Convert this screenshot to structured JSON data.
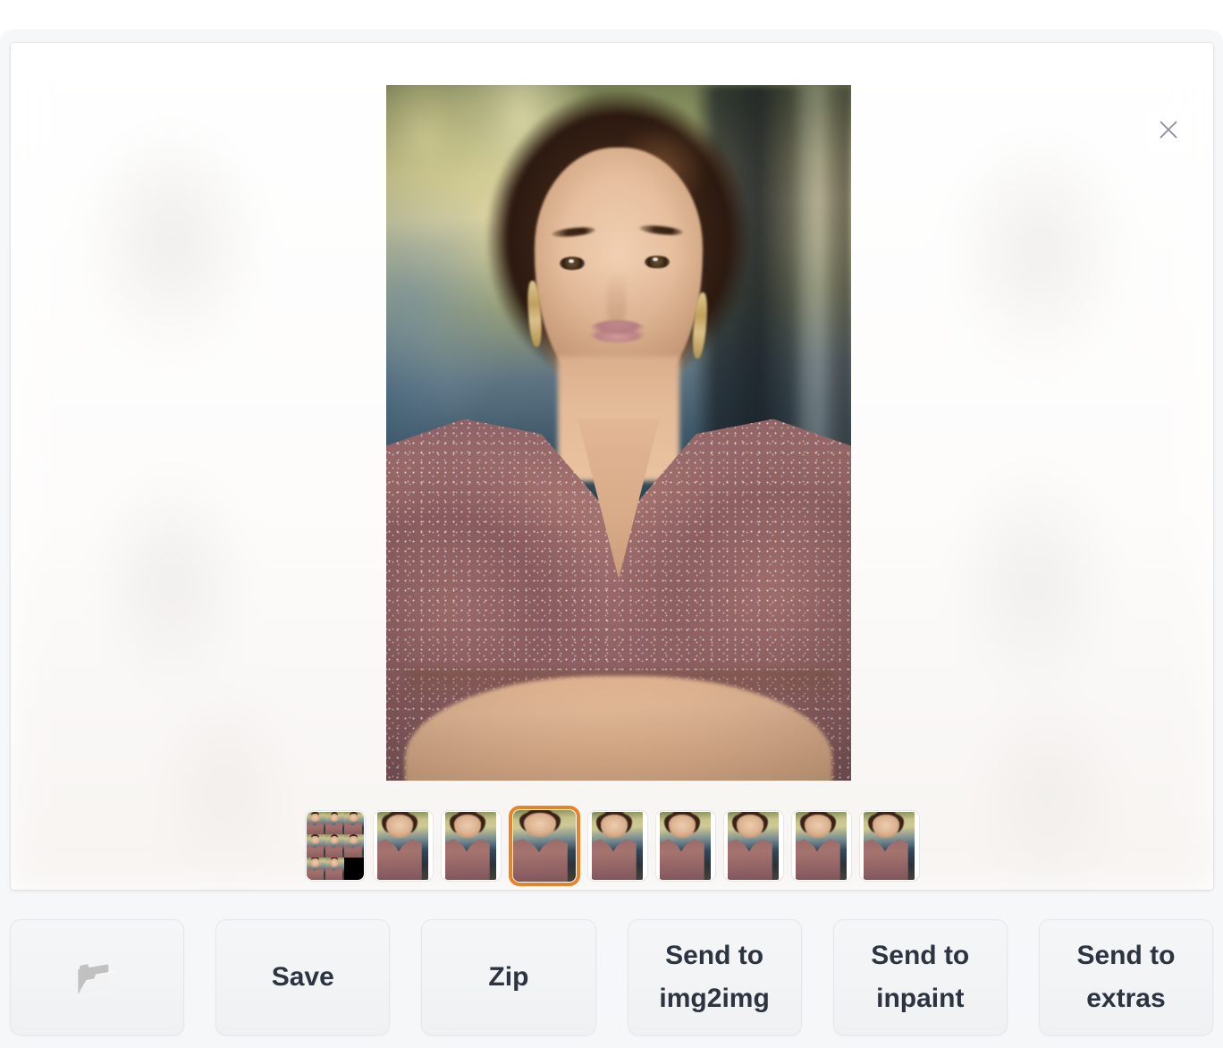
{
  "window": {
    "background_color": "#ffffff",
    "container_color": "#f6f7f9"
  },
  "preview": {
    "close_label": "Close",
    "close_icon": "close-icon",
    "main_image_alt": "Portrait of a woman with dark updo hair, gold drop earrings, and a sparkly mauve wrap dress standing with arms crossed outdoors"
  },
  "gallery": {
    "selected_index": 3,
    "selected_border_color": "#e8832a",
    "thumbnails": [
      {
        "label": "Grid montage of 9 generated images",
        "kind": "grid"
      },
      {
        "label": "Generated image 1",
        "kind": "photo"
      },
      {
        "label": "Generated image 2",
        "kind": "photo"
      },
      {
        "label": "Generated image 3",
        "kind": "photo"
      },
      {
        "label": "Generated image 4",
        "kind": "photo"
      },
      {
        "label": "Generated image 5",
        "kind": "photo"
      },
      {
        "label": "Generated image 6",
        "kind": "photo"
      },
      {
        "label": "Generated image 7",
        "kind": "photo"
      },
      {
        "label": "Generated image 8",
        "kind": "photo"
      }
    ]
  },
  "actions": {
    "buttons": [
      {
        "name": "open-folder-button",
        "label": "📂",
        "icon": "open-folder-icon",
        "is_icon": true
      },
      {
        "name": "save-button",
        "label": "Save",
        "is_icon": false
      },
      {
        "name": "zip-button",
        "label": "Zip",
        "is_icon": false
      },
      {
        "name": "send-to-img2img-button",
        "label": "Send to img2img",
        "is_icon": false
      },
      {
        "name": "send-to-inpaint-button",
        "label": "Send to inpaint",
        "is_icon": false
      },
      {
        "name": "send-to-extras-button",
        "label": "Send to extras",
        "is_icon": false
      }
    ],
    "text_color": "#2b3440"
  }
}
